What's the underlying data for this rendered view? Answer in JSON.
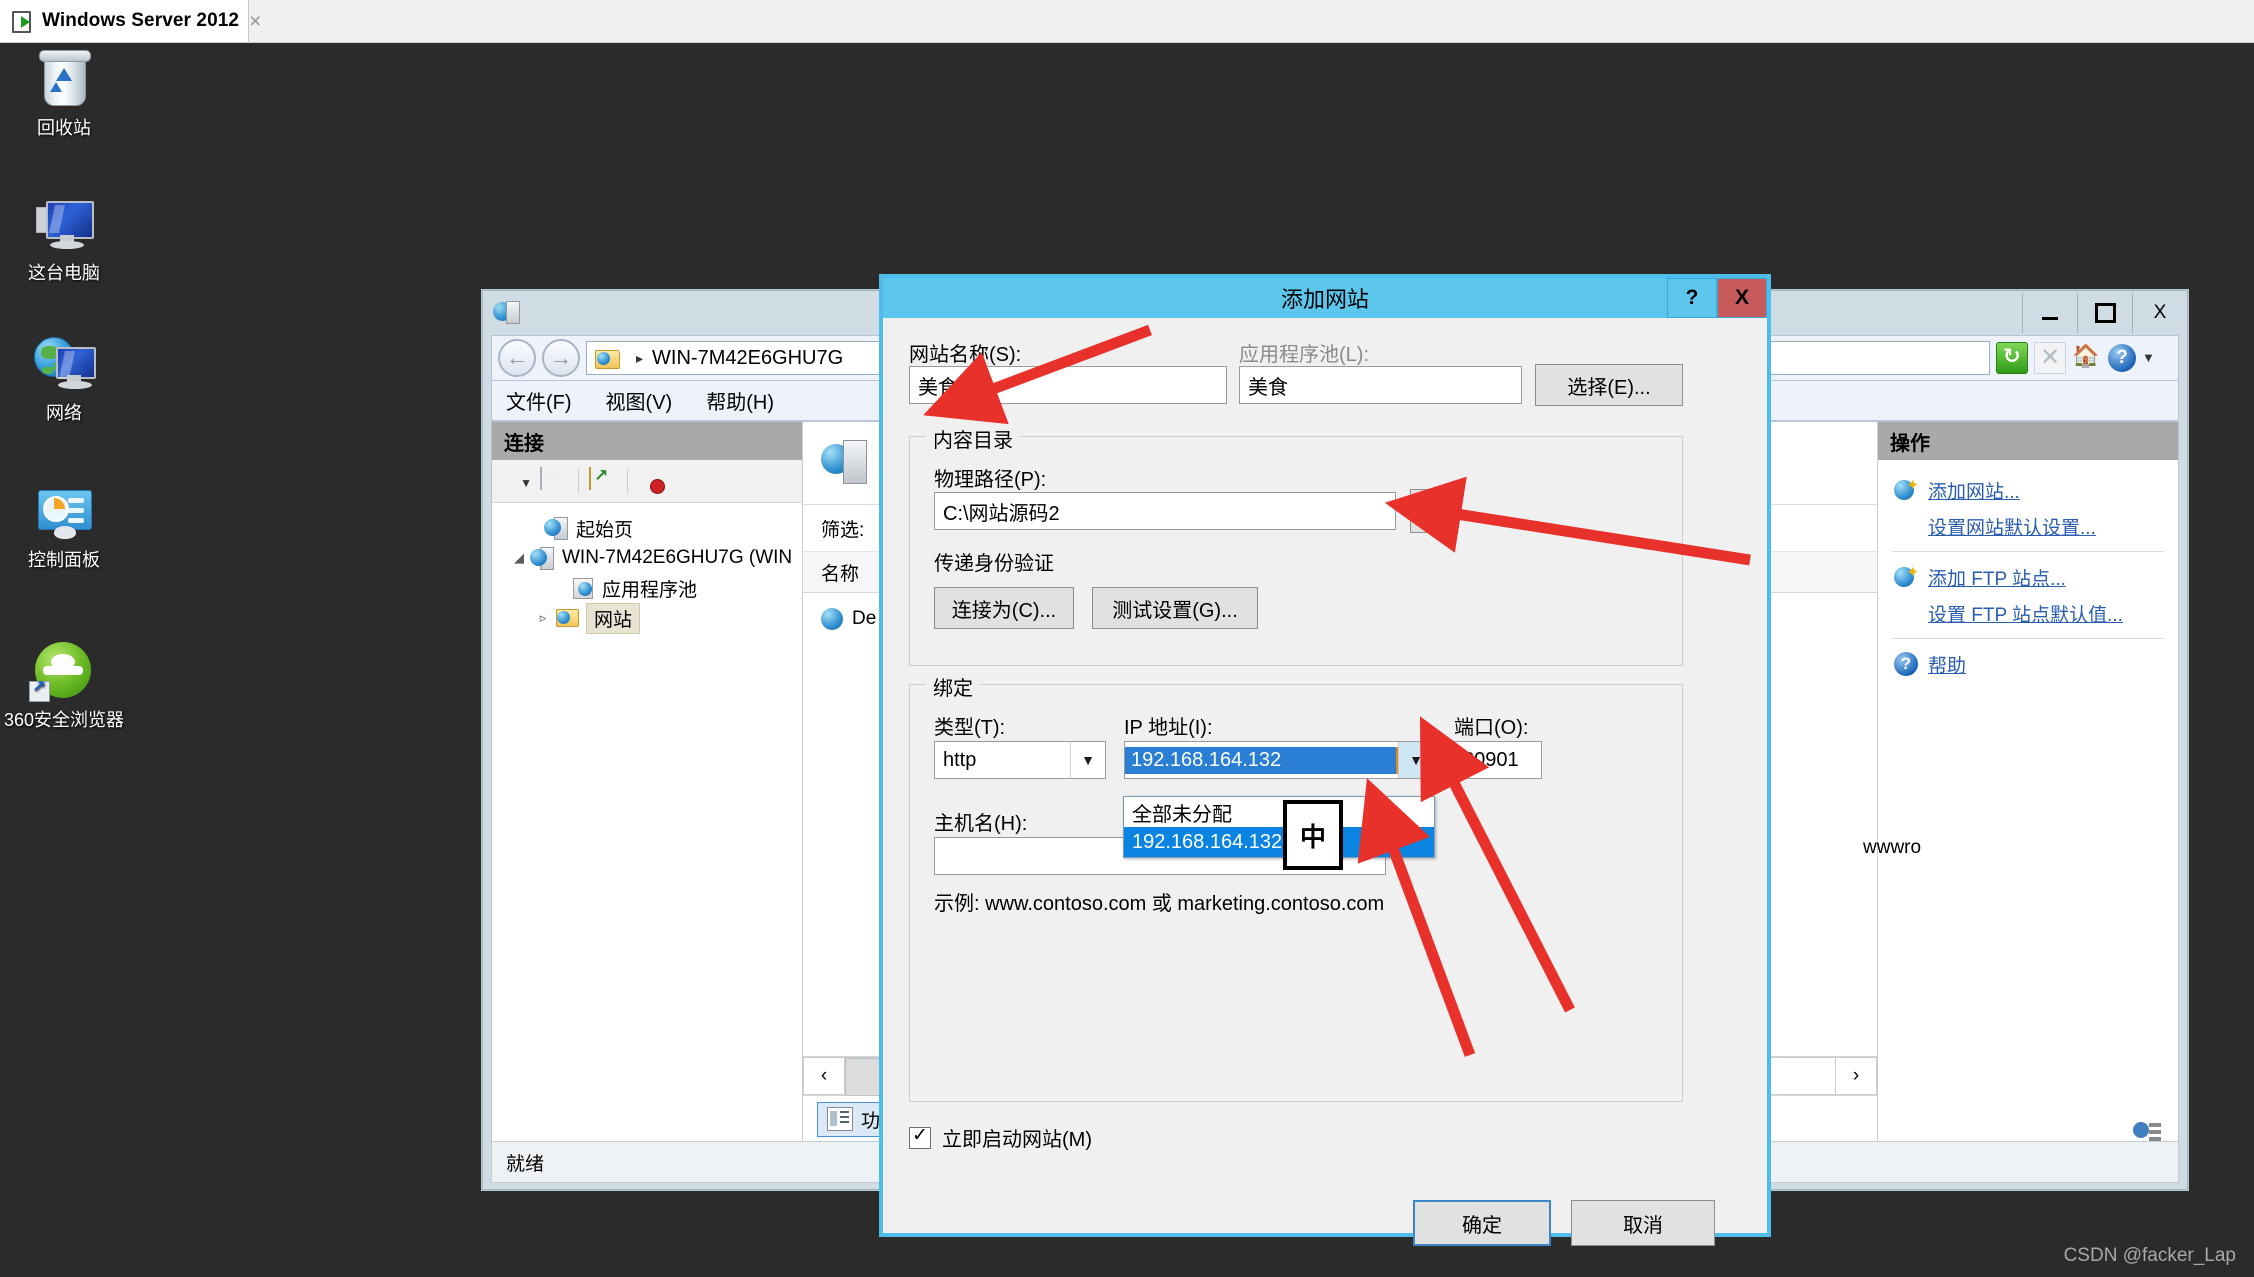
{
  "host_tab": {
    "title": "Windows Server 2012",
    "close_label": "×",
    "icon": "vm-screen-play-icon"
  },
  "desktop": {
    "icons": [
      {
        "label": "回收站",
        "icon": "recycle-bin-icon"
      },
      {
        "label": "这台电脑",
        "icon": "computer-icon"
      },
      {
        "label": "网络",
        "icon": "network-icon"
      },
      {
        "label": "控制面板",
        "icon": "control-panel-icon"
      },
      {
        "label": "360安全浏览器",
        "icon": "360-browser-icon"
      }
    ]
  },
  "iis": {
    "window_buttons": {
      "minimize": "–",
      "maximize": "□",
      "close": "X"
    },
    "breadcrumb": {
      "separator": "▸",
      "server": "WIN-7M42E6GHU7G"
    },
    "nav": {
      "back": "←",
      "forward": "→"
    },
    "toolbar_icons": [
      "refresh-icon",
      "stop-icon",
      "home-icon",
      "help-icon",
      "dropdown-caret-icon"
    ],
    "menu": [
      "文件(F)",
      "视图(V)",
      "帮助(H)"
    ],
    "connections": {
      "header": "连接",
      "tools": [
        "connect-globe-icon",
        "save-icon",
        "connect-to-site-icon",
        "disconnect-icon"
      ],
      "tree": [
        {
          "label": "起始页",
          "twisty": "",
          "icon": "start-page-icon",
          "selected": false
        },
        {
          "label": "WIN-7M42E6GHU7G (WIN",
          "twisty": "◢",
          "icon": "server-icon",
          "selected": false
        },
        {
          "label": "应用程序池",
          "twisty": "",
          "icon": "app-pools-icon",
          "selected": false
        },
        {
          "label": "网站",
          "twisty": "▹",
          "icon": "sites-folder-icon",
          "selected": true
        }
      ]
    },
    "center": {
      "filter_label": "筛选:",
      "column_header": "名称",
      "rows": [
        {
          "name": "De"
        }
      ],
      "path_fragment": "wwwro",
      "scroll": {
        "left": "‹",
        "right": "›",
        "thumb": "‖‖"
      },
      "view_button": "功能"
    },
    "actions": {
      "header": "操作",
      "items": [
        {
          "label": "添加网站...",
          "icon": "add-site-icon",
          "sep_after": false
        },
        {
          "label": "设置网站默认设置...",
          "icon": "",
          "sep_after": true
        },
        {
          "label": "添加 FTP 站点...",
          "icon": "add-ftp-site-icon",
          "sep_after": false
        },
        {
          "label": "设置 FTP 站点默认值...",
          "icon": "",
          "sep_after": true
        },
        {
          "label": "帮助",
          "icon": "help-icon",
          "sep_after": false
        }
      ]
    },
    "status": "就绪"
  },
  "dialog": {
    "title": "添加网站",
    "help_button": "?",
    "close_button": "X",
    "site_name": {
      "label": "网站名称(S):",
      "value": "美食"
    },
    "app_pool": {
      "label": "应用程序池(L):",
      "value": "美食",
      "select_button": "选择(E)..."
    },
    "content_dir": {
      "group_title": "内容目录",
      "physical_path": {
        "label": "物理路径(P):",
        "value": "C:\\网站源码2"
      },
      "browse_button": "...",
      "passthrough_label": "传递身份验证",
      "connect_as_button": "连接为(C)...",
      "test_settings_button": "测试设置(G)..."
    },
    "binding": {
      "group_title": "绑定",
      "type": {
        "label": "类型(T):",
        "value": "http"
      },
      "ip": {
        "label": "IP 地址(I):",
        "value": "192.168.164.132",
        "options": [
          "全部未分配",
          "192.168.164.132"
        ],
        "selected_option": "192.168.164.132"
      },
      "port": {
        "label": "端口(O):",
        "value": "80901"
      },
      "host": {
        "label": "主机名(H):",
        "value": ""
      },
      "example": "示例: www.contoso.com 或 marketing.contoso.com"
    },
    "start_immediately": {
      "label": "立即启动网站(M)",
      "checked": true
    },
    "ok_button": "确定",
    "cancel_button": "取消"
  },
  "ime_indicator": "中",
  "watermark": "CSDN @facker_Lap",
  "colors": {
    "dialog_accent": "#5dc6ed",
    "dialog_border": "#4fbde9",
    "close_red": "#c75b5b",
    "highlight_blue": "#0a84e0",
    "annotation_red": "#e8312a",
    "link_blue": "#2a5db0",
    "desktop_bg": "#2b2b2b"
  }
}
